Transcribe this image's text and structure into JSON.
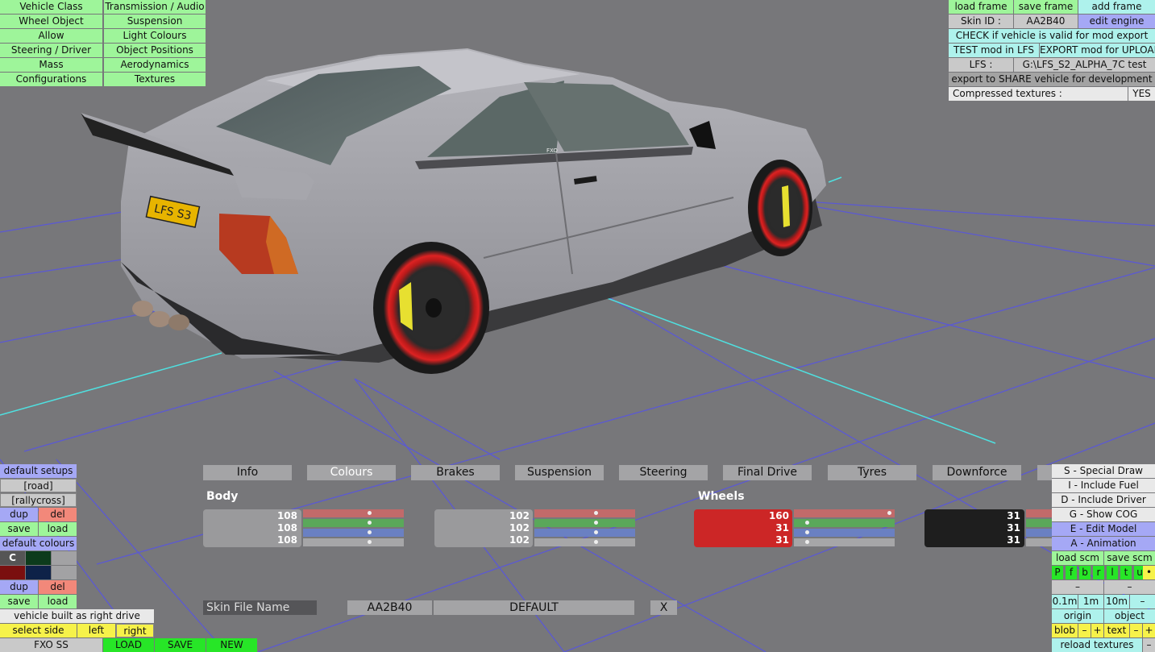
{
  "top_left_menu": [
    [
      "Vehicle Class",
      "Transmission / Audio"
    ],
    [
      "Wheel Object",
      "Suspension"
    ],
    [
      "Allow",
      "Light Colours"
    ],
    [
      "Steering / Driver",
      "Object Positions"
    ],
    [
      "Mass",
      "Aerodynamics"
    ],
    [
      "Configurations",
      "Textures"
    ]
  ],
  "top_right": {
    "load_frame": "load frame",
    "save_frame": "save frame",
    "add_frame": "add frame",
    "skin_id_label": "Skin ID :",
    "skin_id_value": "AA2B40",
    "edit_engine": "edit engine",
    "check_valid": "CHECK if vehicle is valid for mod export",
    "test_mod": "TEST mod in LFS",
    "export_mod": "EXPORT mod for UPLOAD",
    "lfs_label": "LFS :",
    "lfs_path": "G:\\LFS_S2_ALPHA_7C test",
    "export_share": "export to SHARE vehicle for development",
    "compressed_label": "Compressed textures :",
    "compressed_value": "YES"
  },
  "car": {
    "plate": "LFS S3",
    "badge": "FXO"
  },
  "tabs": [
    "Info",
    "Colours",
    "Brakes",
    "Suspension",
    "Steering",
    "Final Drive",
    "Tyres",
    "Downforce"
  ],
  "active_tab": "Colours",
  "colours": {
    "body_label": "Body",
    "wheels_label": "Wheels",
    "body_1": {
      "r": 108,
      "g": 108,
      "b": 108,
      "color": "#6c6c6c"
    },
    "body_2": {
      "r": 102,
      "g": 102,
      "b": 102,
      "color": "#666666"
    },
    "wheels_1": {
      "r": 160,
      "g": 31,
      "b": 31,
      "color": "#c82222"
    },
    "wheels_2": {
      "r": 31,
      "g": 31,
      "b": 31,
      "color": "#1f1f1f"
    }
  },
  "skin": {
    "label": "Skin File Name",
    "id": "AA2B40",
    "name": "DEFAULT",
    "close": "X"
  },
  "left_panel": {
    "default_setups": "default setups",
    "road": "[road]",
    "rallycross": "[rallycross]",
    "dup": "dup",
    "del": "del",
    "save": "save",
    "load": "load",
    "default_colours": "default colours",
    "c_label": "C",
    "right_drive": "vehicle built as right drive",
    "select_side": "select side",
    "left": "left",
    "right": "right",
    "car_name": "FXO SS",
    "load_caps": "LOAD",
    "save_caps": "SAVE",
    "new_caps": "NEW"
  },
  "right_panel": {
    "special_draw": "S - Special Draw",
    "include_fuel": "I - Include Fuel",
    "include_driver": "D - Include Driver",
    "show_cog": "G - Show COG",
    "edit_model": "E - Edit Model",
    "animation": "A - Animation",
    "load_scm": "load scm",
    "save_scm": "save scm",
    "p_buttons": [
      "P",
      "f",
      "b",
      "r",
      "l",
      "t",
      "u"
    ],
    "dot": "•",
    "dash": "–",
    "step_01": "0.1m",
    "step_1": "1m",
    "step_10": "10m",
    "minus": "–",
    "origin": "origin",
    "object": "object",
    "blob": "blob",
    "plus": "+",
    "text": "text",
    "reload": "reload textures"
  }
}
